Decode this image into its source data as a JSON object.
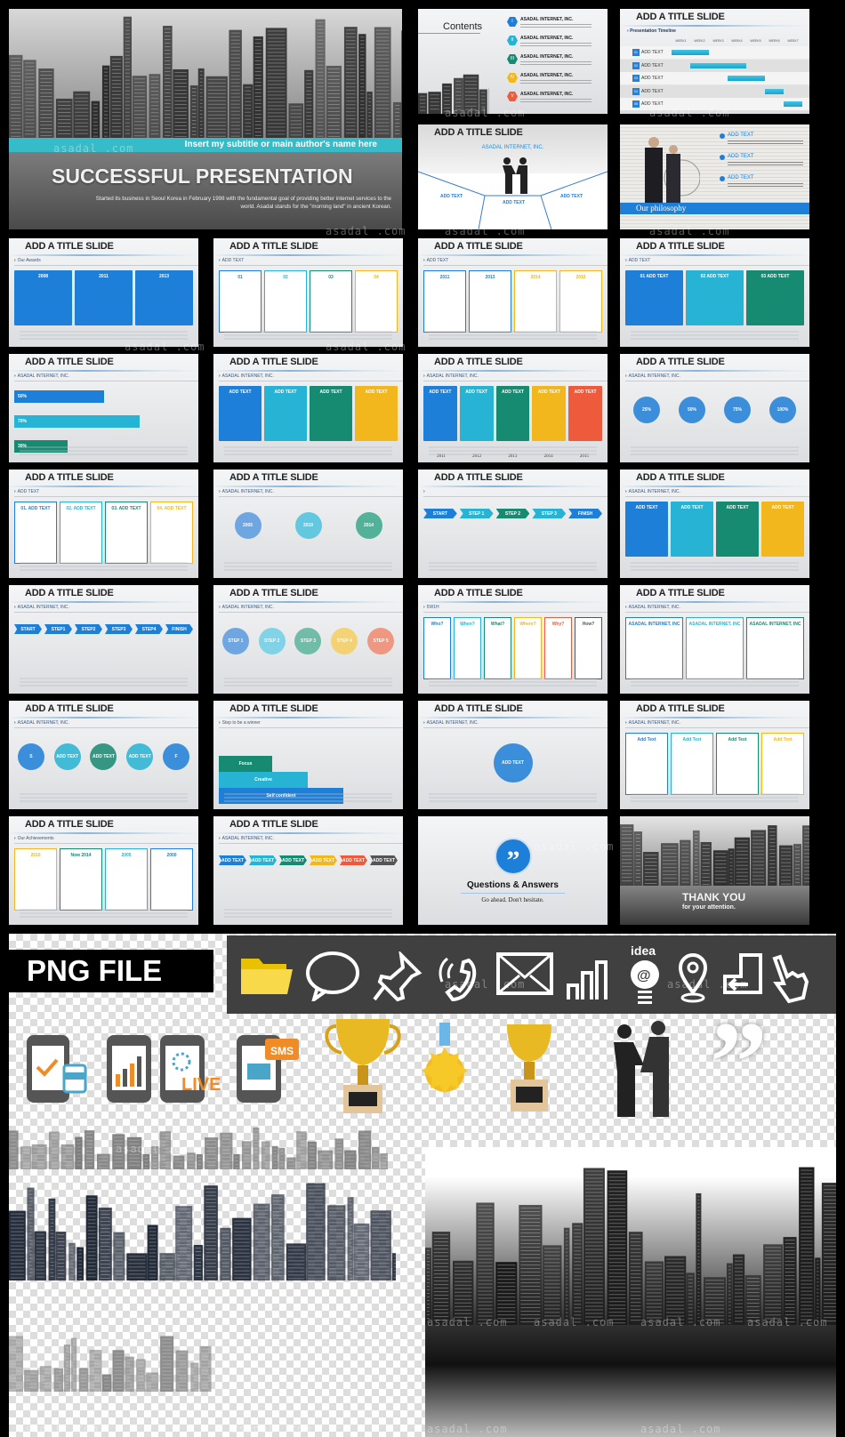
{
  "watermark": "asadal .com",
  "palette": {
    "blue": "#1e7fd8",
    "cyan": "#27b3d3",
    "green": "#178a72",
    "yellow": "#f2b71d",
    "red": "#ee5a3c",
    "gray": "#555555",
    "teal": "#3bbfcc"
  },
  "cover": {
    "subtitle": "Insert my subtitle or main author's name here",
    "title": "SUCCESSFUL PRESENTATION",
    "description": "Started its business in Seoul Korea in February 1998 with the fundamental goal of providing better internet services to the world. Asadal stands for the \"morning land\" in ancient Korean."
  },
  "contents": {
    "title": "Contents",
    "items": [
      {
        "num": "I",
        "label": "ASADAL INTERNET, INC.",
        "color": "#1e7fd8"
      },
      {
        "num": "II",
        "label": "ASADAL INTERNET, INC.",
        "color": "#27b3d3"
      },
      {
        "num": "III",
        "label": "ASADAL INTERNET, INC.",
        "color": "#178a72"
      },
      {
        "num": "IV",
        "label": "ASADAL INTERNET, INC.",
        "color": "#f2b71d"
      },
      {
        "num": "V",
        "label": "ASADAL INTERNET, INC.",
        "color": "#ee5a3c"
      }
    ]
  },
  "timeline": {
    "title": "ADD A TITLE SLIDE",
    "label": "Presentation Timeline",
    "weeks": [
      "WEEK1",
      "WEEK2",
      "WEEK3",
      "WEEK4",
      "WEEK5",
      "WEEK6",
      "WEEK7"
    ],
    "rows": [
      {
        "num": "01",
        "label": "ADD TEXT",
        "start": 0,
        "end": 2
      },
      {
        "num": "02",
        "label": "ADD TEXT",
        "start": 1,
        "end": 4
      },
      {
        "num": "03",
        "label": "ADD TEXT",
        "start": 3,
        "end": 5
      },
      {
        "num": "04",
        "label": "ADD TEXT",
        "start": 5,
        "end": 6
      },
      {
        "num": "05",
        "label": "ADD TEXT",
        "start": 6,
        "end": 7
      }
    ]
  },
  "handshake": {
    "title": "ADD A TITLE SLIDE",
    "company": "ASADAL INTERNET, INC.",
    "items": [
      "ADD TEXT",
      "ADD TEXT",
      "ADD TEXT"
    ]
  },
  "philosophy": {
    "items": [
      "ADD TEXT",
      "ADD TEXT",
      "ADD TEXT"
    ],
    "banner": "Our philosophy"
  },
  "slides": [
    {
      "title": "ADD A TITLE SLIDE",
      "label": "Our Awards",
      "kind": "cards",
      "items": [
        {
          "text": "2008",
          "color": "#1e7fd8"
        },
        {
          "text": "2011",
          "color": "#1e7fd8"
        },
        {
          "text": "2013",
          "color": "#1e7fd8"
        }
      ]
    },
    {
      "title": "ADD A TITLE SLIDE",
      "label": "ADD TEXT",
      "kind": "outline",
      "items": [
        {
          "text": "01",
          "color": "#1e7fd8"
        },
        {
          "text": "02",
          "color": "#27b3d3"
        },
        {
          "text": "03",
          "color": "#178a72"
        },
        {
          "text": "04",
          "color": "#f2b71d"
        }
      ]
    },
    {
      "title": "ADD A TITLE SLIDE",
      "label": "ADD TEXT",
      "kind": "outline",
      "items": [
        {
          "text": "2011",
          "color": "#1e7fd8"
        },
        {
          "text": "2013",
          "color": "#1e7fd8"
        },
        {
          "text": "2014",
          "color": "#f2b71d"
        },
        {
          "text": "2015",
          "color": "#f2b71d"
        }
      ]
    },
    {
      "title": "ADD A TITLE SLIDE",
      "label": "ADD TEXT",
      "kind": "cards",
      "items": [
        {
          "text": "01 ADD TEXT",
          "color": "#1e7fd8"
        },
        {
          "text": "02 ADD TEXT",
          "color": "#27b3d3"
        },
        {
          "text": "03 ADD TEXT",
          "color": "#178a72"
        }
      ]
    },
    {
      "title": "ADD A TITLE SLIDE",
      "label": "ASADAL INTERNET, INC.",
      "kind": "bars",
      "items": [
        {
          "text": "50%",
          "color": "#1e7fd8"
        },
        {
          "text": "70%",
          "color": "#27b3d3"
        },
        {
          "text": "30%",
          "color": "#178a72"
        }
      ]
    },
    {
      "title": "ADD A TITLE SLIDE",
      "label": "ASADAL INTERNET, INC.",
      "kind": "cards",
      "items": [
        {
          "text": "ADD TEXT",
          "color": "#1e7fd8"
        },
        {
          "text": "ADD TEXT",
          "color": "#27b3d3"
        },
        {
          "text": "ADD TEXT",
          "color": "#178a72"
        },
        {
          "text": "ADD TEXT",
          "color": "#f2b71d"
        }
      ]
    },
    {
      "title": "ADD A TITLE SLIDE",
      "label": "ASADAL INTERNET, INC.",
      "kind": "cards",
      "items": [
        {
          "text": "ADD TEXT",
          "color": "#1e7fd8"
        },
        {
          "text": "ADD TEXT",
          "color": "#27b3d3"
        },
        {
          "text": "ADD TEXT",
          "color": "#178a72"
        },
        {
          "text": "ADD TEXT",
          "color": "#f2b71d"
        },
        {
          "text": "ADD TEXT",
          "color": "#ee5a3c"
        }
      ],
      "footer": [
        "2011",
        "2012",
        "2013",
        "2014",
        "2015"
      ]
    },
    {
      "title": "ADD A TITLE SLIDE",
      "label": "ASADAL INTERNET, INC.",
      "kind": "circles",
      "items": [
        {
          "text": "25%",
          "color": "#1e7fd8"
        },
        {
          "text": "50%",
          "color": "#1e7fd8"
        },
        {
          "text": "75%",
          "color": "#1e7fd8"
        },
        {
          "text": "100%",
          "color": "#1e7fd8"
        }
      ]
    },
    {
      "title": "ADD A TITLE SLIDE",
      "label": "ADD TEXT",
      "kind": "outline",
      "items": [
        {
          "text": "01. ADD TEXT",
          "color": "#1e7fd8"
        },
        {
          "text": "02. ADD TEXT",
          "color": "#27b3d3"
        },
        {
          "text": "03. ADD TEXT",
          "color": "#178a72"
        },
        {
          "text": "04. ADD TEXT",
          "color": "#f2b71d"
        }
      ]
    },
    {
      "title": "ADD A TITLE SLIDE",
      "label": "ASADAL INTERNET, INC.",
      "kind": "circles",
      "items": [
        {
          "text": "2005",
          "color": "#5a9be0"
        },
        {
          "text": "2010",
          "color": "#4cc3dd"
        },
        {
          "text": "2014",
          "color": "#3aa88c"
        }
      ]
    },
    {
      "title": "ADD A TITLE SLIDE",
      "label": "",
      "kind": "arrows",
      "items": [
        {
          "text": "START",
          "color": "#1e7fd8"
        },
        {
          "text": "STEP 1",
          "color": "#27b3d3"
        },
        {
          "text": "STEP 2",
          "color": "#178a72"
        },
        {
          "text": "STEP 3",
          "color": "#27b3d3"
        },
        {
          "text": "FINISH",
          "color": "#1e7fd8"
        }
      ]
    },
    {
      "title": "ADD A TITLE SLIDE",
      "label": "ASADAL INTERNET, INC.",
      "kind": "cards",
      "items": [
        {
          "text": "ADD TEXT",
          "color": "#1e7fd8"
        },
        {
          "text": "ADD TEXT",
          "color": "#27b3d3"
        },
        {
          "text": "ADD TEXT",
          "color": "#178a72"
        },
        {
          "text": "ADD TEXT",
          "color": "#f2b71d"
        }
      ]
    },
    {
      "title": "ADD A TITLE SLIDE",
      "label": "ASADAL INTERNET, INC.",
      "kind": "arrows",
      "items": [
        {
          "text": "START",
          "color": "#1e7fd8"
        },
        {
          "text": "STEP1",
          "color": "#1e7fd8"
        },
        {
          "text": "STEP2",
          "color": "#1e7fd8"
        },
        {
          "text": "STEP3",
          "color": "#1e7fd8"
        },
        {
          "text": "STEP4",
          "color": "#1e7fd8"
        },
        {
          "text": "FINISH",
          "color": "#1e7fd8"
        }
      ]
    },
    {
      "title": "ADD A TITLE SLIDE",
      "label": "ASADAL INTERNET, INC.",
      "kind": "circles",
      "items": [
        {
          "text": "STEP 1",
          "color": "#5a9be0"
        },
        {
          "text": "STEP 2",
          "color": "#6fcfe6"
        },
        {
          "text": "STEP 3",
          "color": "#5bb59d"
        },
        {
          "text": "STEP 4",
          "color": "#f5cf60"
        },
        {
          "text": "STEP 5",
          "color": "#f08a70"
        }
      ]
    },
    {
      "title": "ADD A TITLE SLIDE",
      "label": "5W1H",
      "kind": "outline",
      "items": [
        {
          "text": "Who?",
          "color": "#1e7fd8"
        },
        {
          "text": "When?",
          "color": "#27b3d3"
        },
        {
          "text": "What?",
          "color": "#178a72"
        },
        {
          "text": "Where?",
          "color": "#f2b71d"
        },
        {
          "text": "Why?",
          "color": "#ee5a3c"
        },
        {
          "text": "How?",
          "color": "#555555"
        }
      ]
    },
    {
      "title": "ADD A TITLE SLIDE",
      "label": "ASADAL INTERNET, INC.",
      "kind": "outline",
      "items": [
        {
          "text": "ASADAL INTERNET, INC",
          "color": "#1e7fd8"
        },
        {
          "text": "ASADAL INTERNET, INC",
          "color": "#27b3d3"
        },
        {
          "text": "ASADAL INTERNET, INC",
          "color": "#178a72"
        }
      ]
    },
    {
      "title": "ADD A TITLE SLIDE",
      "label": "ASADAL INTERNET, INC.",
      "kind": "circles",
      "items": [
        {
          "text": "S",
          "color": "#1e7fd8"
        },
        {
          "text": "ADD TEXT",
          "color": "#27b3d3"
        },
        {
          "text": "ADD TEXT",
          "color": "#178a72"
        },
        {
          "text": "ADD TEXT",
          "color": "#27b3d3"
        },
        {
          "text": "F",
          "color": "#1e7fd8"
        }
      ]
    },
    {
      "title": "ADD A TITLE SLIDE",
      "label": "Step to be a winner",
      "kind": "pyramid",
      "items": [
        {
          "text": "Focus",
          "color": "#178a72"
        },
        {
          "text": "Creative",
          "color": "#27b3d3"
        },
        {
          "text": "Self confident",
          "color": "#1e7fd8"
        }
      ]
    },
    {
      "title": "ADD A TITLE SLIDE",
      "label": "ASADAL INTERNET, INC.",
      "kind": "circles",
      "items": [
        {
          "text": "ADD TEXT",
          "color": "#1e7fd8"
        }
      ]
    },
    {
      "title": "ADD A TITLE SLIDE",
      "label": "ASADAL INTERNET, INC.",
      "kind": "outline",
      "items": [
        {
          "text": "Add Text",
          "color": "#1e7fd8"
        },
        {
          "text": "Add Text",
          "color": "#27b3d3"
        },
        {
          "text": "Add Text",
          "color": "#178a72"
        },
        {
          "text": "Add Text",
          "color": "#f2b71d"
        }
      ]
    },
    {
      "title": "ADD A TITLE SLIDE",
      "label": "Our Achievements",
      "kind": "outline",
      "items": [
        {
          "text": "2010",
          "color": "#f2b71d"
        },
        {
          "text": "Now 2014",
          "color": "#178a72"
        },
        {
          "text": "2005",
          "color": "#27b3d3"
        },
        {
          "text": "2000",
          "color": "#1e7fd8"
        }
      ]
    },
    {
      "title": "ADD A TITLE SLIDE",
      "label": "ASADAL INTERNET, INC.",
      "kind": "arrows",
      "items": [
        {
          "text": "ADD TEXT",
          "color": "#1e7fd8"
        },
        {
          "text": "ADD TEXT",
          "color": "#27b3d3"
        },
        {
          "text": "ADD TEXT",
          "color": "#178a72"
        },
        {
          "text": "ADD TEXT",
          "color": "#f2b71d"
        },
        {
          "text": "ADD TEXT",
          "color": "#ee5a3c"
        },
        {
          "text": "ADD TEXT",
          "color": "#555555"
        }
      ]
    }
  ],
  "qa": {
    "title": "Questions & Answers",
    "subtitle": "Go ahead. Don't hesitate."
  },
  "thanks": {
    "title": "THANK YOU",
    "subtitle": "for your attention."
  },
  "png": {
    "label": "PNG FILE",
    "icons": [
      "folder-icon",
      "speech-bubble-icon",
      "pushpin-icon",
      "phone-icon",
      "mail-icon",
      "signal-bars-icon",
      "idea-bulb-icon",
      "location-pin-icon",
      "login-icon",
      "hand-pointer-icon"
    ],
    "idea_text": "idea",
    "live_text": "LIVE",
    "sms_text": "SMS"
  }
}
